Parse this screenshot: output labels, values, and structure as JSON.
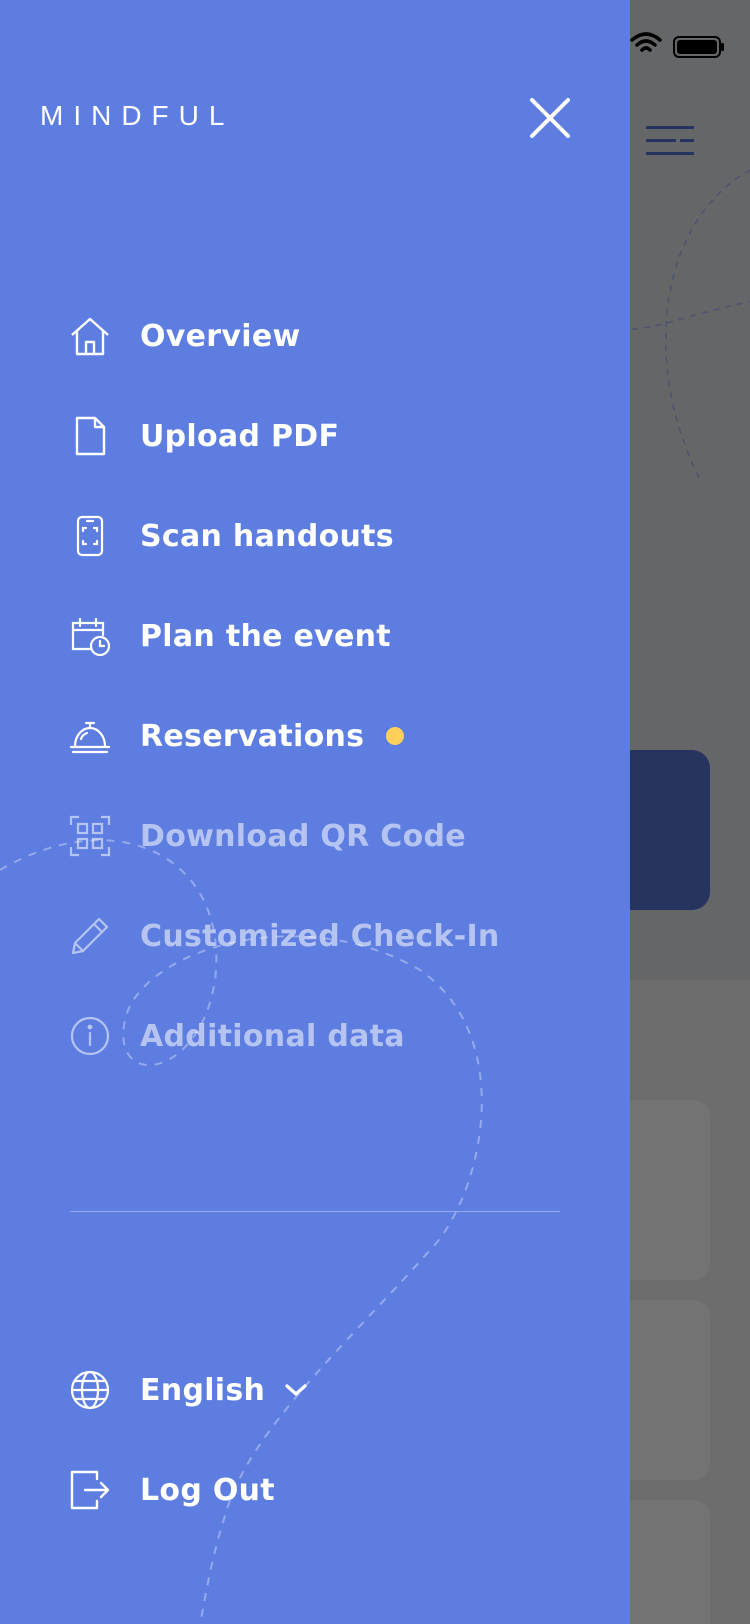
{
  "app": {
    "logo_text": "MINDFUL"
  },
  "drawer": {
    "items": [
      {
        "label": "Overview",
        "icon": "home-icon",
        "enabled": true
      },
      {
        "label": "Upload PDF",
        "icon": "document-icon",
        "enabled": true
      },
      {
        "label": "Scan handouts",
        "icon": "phone-scan-icon",
        "enabled": true
      },
      {
        "label": "Plan the event",
        "icon": "calendar-clock-icon",
        "enabled": true
      },
      {
        "label": "Reservations",
        "icon": "service-bell-icon",
        "enabled": true,
        "badge": "notification-dot"
      },
      {
        "label": "Download QR Code",
        "icon": "qr-code-icon",
        "enabled": false
      },
      {
        "label": "Customized Check-In",
        "icon": "pencil-icon",
        "enabled": false
      },
      {
        "label": "Additional data",
        "icon": "info-icon",
        "enabled": false
      }
    ],
    "language": {
      "label": "English",
      "icon": "globe-icon"
    },
    "logout": {
      "label": "Log Out",
      "icon": "logout-icon"
    }
  },
  "colors": {
    "drawer_bg": "#5d7de1",
    "overlay_bg": "#656667",
    "accent_dot": "#ffcf5c",
    "text": "#ffffff"
  }
}
